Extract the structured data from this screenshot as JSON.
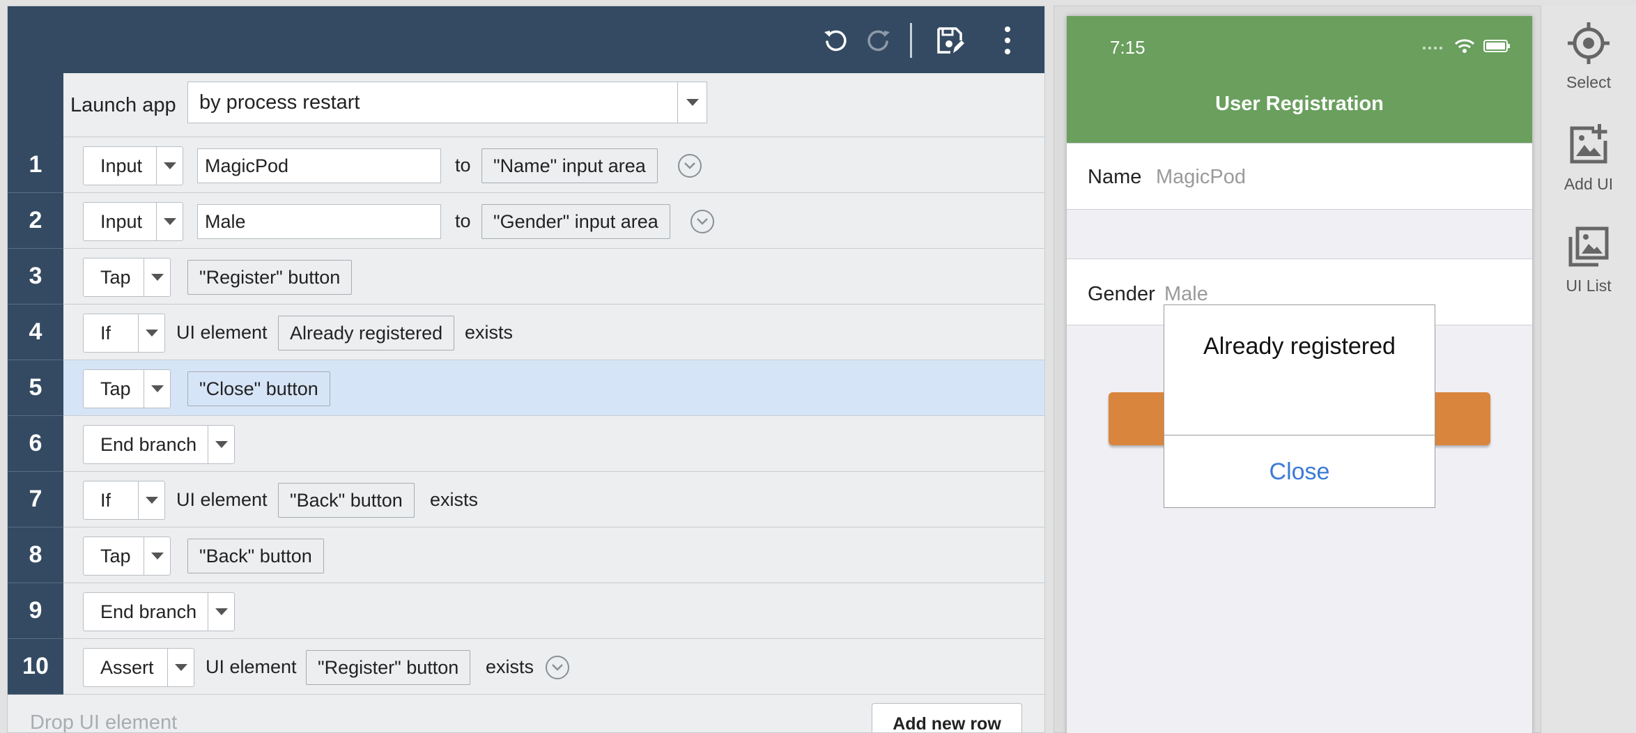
{
  "toolbar": {
    "icons": [
      "undo-icon",
      "redo-icon",
      "save-icon",
      "more-vert-icon"
    ]
  },
  "launch": {
    "label": "Launch app",
    "value": "by process restart"
  },
  "steps": [
    {
      "num": "1",
      "command": "Input",
      "value": "MagicPod",
      "word1": "to",
      "target": "\"Name\" input area"
    },
    {
      "num": "2",
      "command": "Input",
      "value": "Male",
      "word1": "to",
      "target": "\"Gender\" input area"
    },
    {
      "num": "3",
      "command": "Tap",
      "target": "\"Register\" button"
    },
    {
      "num": "4",
      "command": "If",
      "word1": "UI element",
      "target": "Already registered",
      "word2": "exists"
    },
    {
      "num": "5",
      "command": "Tap",
      "target": "\"Close\" button"
    },
    {
      "num": "6",
      "command": "End branch"
    },
    {
      "num": "7",
      "command": "If",
      "word1": "UI element",
      "target": "\"Back\" button",
      "word2": "exists"
    },
    {
      "num": "8",
      "command": "Tap",
      "target": "\"Back\" button"
    },
    {
      "num": "9",
      "command": "End branch"
    },
    {
      "num": "10",
      "command": "Assert",
      "word1": "UI element",
      "target": "\"Register\" button",
      "word2": "exists"
    }
  ],
  "footer": {
    "drop_hint": "Drop UI element",
    "add_row": "Add new row"
  },
  "phone": {
    "time": "7:15",
    "title": "User Registration",
    "name_label": "Name",
    "name_value": "MagicPod",
    "gender_label": "Gender",
    "gender_value": "Male",
    "alert_title": "Already registered",
    "alert_close": "Close"
  },
  "rail": [
    {
      "label": "Select",
      "icon": "target-icon"
    },
    {
      "label": "Add UI",
      "icon": "add-image-icon"
    },
    {
      "label": "UI List",
      "icon": "image-list-icon"
    }
  ],
  "colors": {
    "header": "#344a62",
    "selected_row": "#d6e4f7",
    "phone_green": "#6a9f5e",
    "register_orange": "#d9853d",
    "link_blue": "#3a7bd5"
  }
}
